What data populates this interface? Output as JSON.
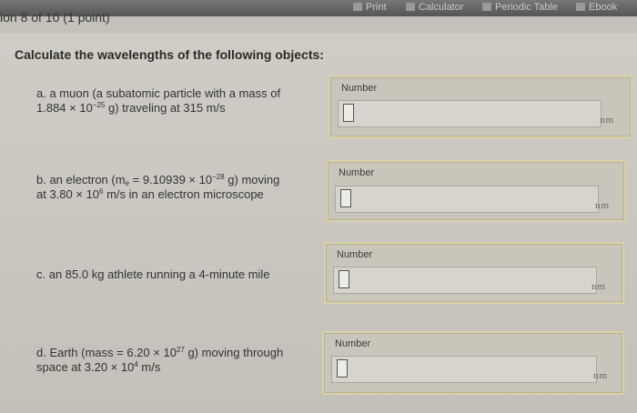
{
  "toolbar": {
    "print_label": "Print",
    "calculator_label": "Calculator",
    "periodic_table_label": "Periodic Table",
    "ebook_label": "Ebook"
  },
  "question": {
    "title": "ion 8 of 10 (1 point)",
    "prompt": "Calculate the wavelengths of the following objects:"
  },
  "parts": [
    {
      "line1_pre": "a. a muon (a subatomic particle with a mass of",
      "line2_mantissa": "1.884 × 10",
      "line2_exp": "−25",
      "line2_post": " g) traveling at 315 m/s",
      "input_label": "Number",
      "unit": "nm",
      "value": ""
    },
    {
      "line1_pre": "b. an electron (m",
      "line1_sub": "e",
      "line1_mid": " = 9.10939 × 10",
      "line1_exp": "−28",
      "line1_post": " g) moving",
      "line2_pre": "at 3.80 × 10",
      "line2_exp": "6",
      "line2_post": " m/s in an electron microscope",
      "input_label": "Number",
      "unit": "nm",
      "value": ""
    },
    {
      "line1_pre": "c. an 85.0 kg athlete running a 4-minute mile",
      "input_label": "Number",
      "unit": "nm",
      "value": ""
    },
    {
      "line1_pre": "d. Earth (mass = 6.20 × 10",
      "line1_exp": "27",
      "line1_post": " g) moving through",
      "line2_pre": "space at 3.20 × 10",
      "line2_exp": "4",
      "line2_post": " m/s",
      "input_label": "Number",
      "unit": "nm",
      "value": ""
    }
  ],
  "colors": {
    "background": "#cbc9c1",
    "panel_border": "#d8d1a8",
    "toolbar": "#666666"
  }
}
